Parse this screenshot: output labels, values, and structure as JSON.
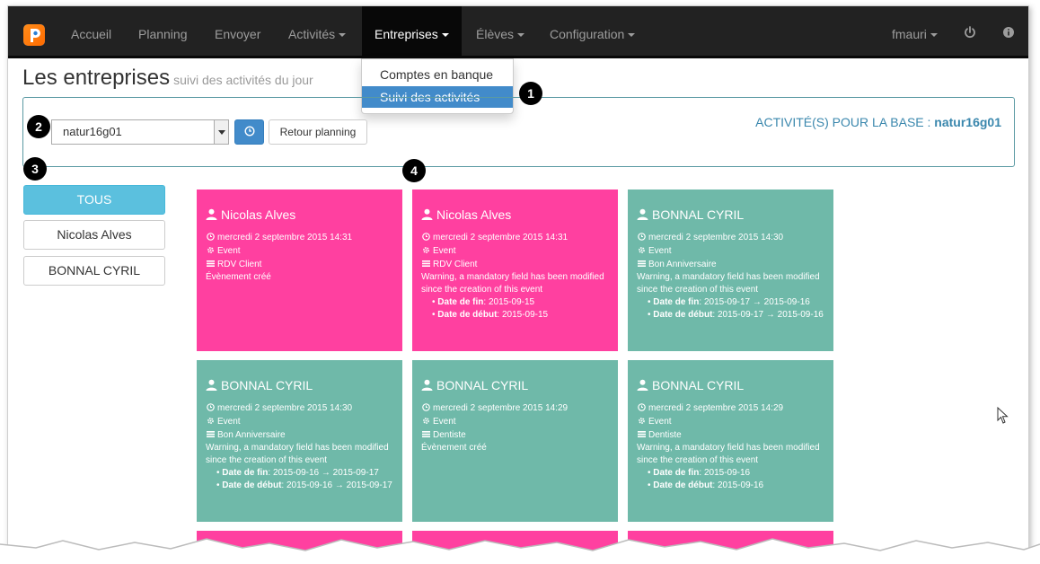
{
  "nav": {
    "items": [
      {
        "label": "Accueil"
      },
      {
        "label": "Planning"
      },
      {
        "label": "Envoyer"
      },
      {
        "label": "Activités"
      },
      {
        "label": "Entreprises"
      },
      {
        "label": "Élèves"
      },
      {
        "label": "Configuration"
      }
    ],
    "user": "fmauri"
  },
  "dropdown": {
    "items": [
      {
        "label": "Comptes en banque"
      },
      {
        "label": "Suivi des activités"
      }
    ]
  },
  "badges": [
    "1",
    "2",
    "3",
    "4"
  ],
  "page": {
    "title": "Les entreprises",
    "subtitle": "suivi des activités du jour"
  },
  "panel": {
    "select_value": "natur16g01",
    "retour_label": "Retour planning",
    "base_prefix": "ACTIVITÉ(S) POUR LA BASE :",
    "base_value": "natur16g01"
  },
  "filters": [
    {
      "label": "TOUS"
    },
    {
      "label": "Nicolas Alves"
    },
    {
      "label": "BONNAL CYRIL"
    }
  ],
  "cards": [
    {
      "name": "Nicolas Alves",
      "color": "#ff40a0",
      "date": "mercredi 2 septembre 2015 14:31",
      "type": "Event",
      "label": "RDV Client",
      "message": "Évènement créé",
      "warning": "",
      "changes": []
    },
    {
      "name": "Nicolas Alves",
      "color": "#ff40a0",
      "date": "mercredi 2 septembre 2015 14:31",
      "type": "Event",
      "label": "RDV Client",
      "message": "",
      "warning": "Warning, a mandatory field has been modified since the creation of this event",
      "changes": [
        {
          "key": "Date de fin",
          "value": ": 2015-09-15"
        },
        {
          "key": "Date de début",
          "value": ": 2015-09-15"
        }
      ]
    },
    {
      "name": "BONNAL CYRIL",
      "color": "#6fb9a9",
      "date": "mercredi 2 septembre 2015 14:30",
      "type": "Event",
      "label": "Bon Anniversaire",
      "message": "",
      "warning": "Warning, a mandatory field has been modified since the creation of this event",
      "changes": [
        {
          "key": "Date de fin",
          "value": ": 2015-09-17 → 2015-09-16"
        },
        {
          "key": "Date de début",
          "value": ": 2015-09-17 → 2015-09-16"
        }
      ]
    },
    {
      "name": "BONNAL CYRIL",
      "color": "#6fb9a9",
      "date": "mercredi 2 septembre 2015 14:30",
      "type": "Event",
      "label": "Bon Anniversaire",
      "message": "",
      "warning": "Warning, a mandatory field has been modified since the creation of this event",
      "changes": [
        {
          "key": "Date de fin",
          "value": ": 2015-09-16 → 2015-09-17"
        },
        {
          "key": "Date de début",
          "value": ": 2015-09-16 → 2015-09-17"
        }
      ]
    },
    {
      "name": "BONNAL CYRIL",
      "color": "#6fb9a9",
      "date": "mercredi 2 septembre 2015 14:29",
      "type": "Event",
      "label": "Dentiste",
      "message": "Évènement créé",
      "warning": "",
      "changes": []
    },
    {
      "name": "BONNAL CYRIL",
      "color": "#6fb9a9",
      "date": "mercredi 2 septembre 2015 14:29",
      "type": "Event",
      "label": "Dentiste",
      "message": "",
      "warning": "Warning, a mandatory field has been modified since the creation of this event",
      "changes": [
        {
          "key": "Date de fin",
          "value": ": 2015-09-16"
        },
        {
          "key": "Date de début",
          "value": ": 2015-09-16"
        }
      ]
    }
  ],
  "colors": {
    "navbar": "#222222",
    "pink": "#ff40a0",
    "teal": "#6fb9a9",
    "primary": "#428bca",
    "info": "#5bc0de"
  },
  "icons": [
    "logo-icon",
    "power-icon",
    "info-icon",
    "clock-icon",
    "user-icon",
    "gear-icon",
    "list-icon",
    "cursor-icon"
  ]
}
